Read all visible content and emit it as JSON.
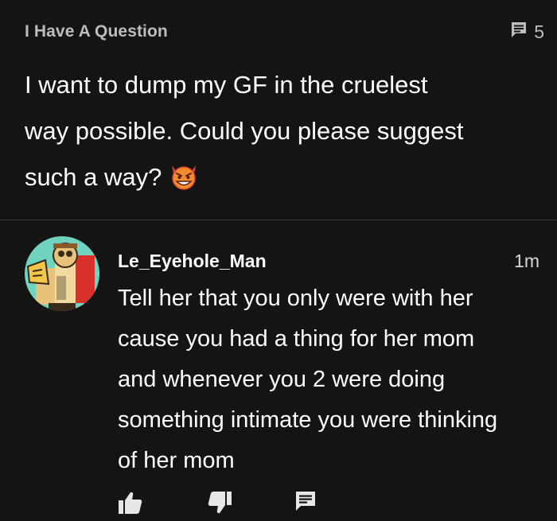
{
  "post": {
    "category": "I Have A Question",
    "comment_count": "5",
    "question_line1": "I want to dump my GF in the cruelest",
    "question_line2": "way possible. Could you please suggest",
    "question_line3": "such a way?",
    "question_emoji": "smiling-devil-emoji"
  },
  "reply": {
    "username": "Le_Eyehole_Man",
    "time": "1m",
    "lines": [
      "Tell her that you only were with her",
      "cause you had a thing for her mom",
      "and whenever you 2 were doing",
      "something intimate you were thinking",
      "of her mom"
    ],
    "actions": [
      "thumbs-up-icon",
      "thumbs-down-icon",
      "reply-icon"
    ]
  },
  "colors": {
    "background": "#141414",
    "text": "#ffffff",
    "muted": "#bdbdbd",
    "divider": "#3a3a3a"
  }
}
